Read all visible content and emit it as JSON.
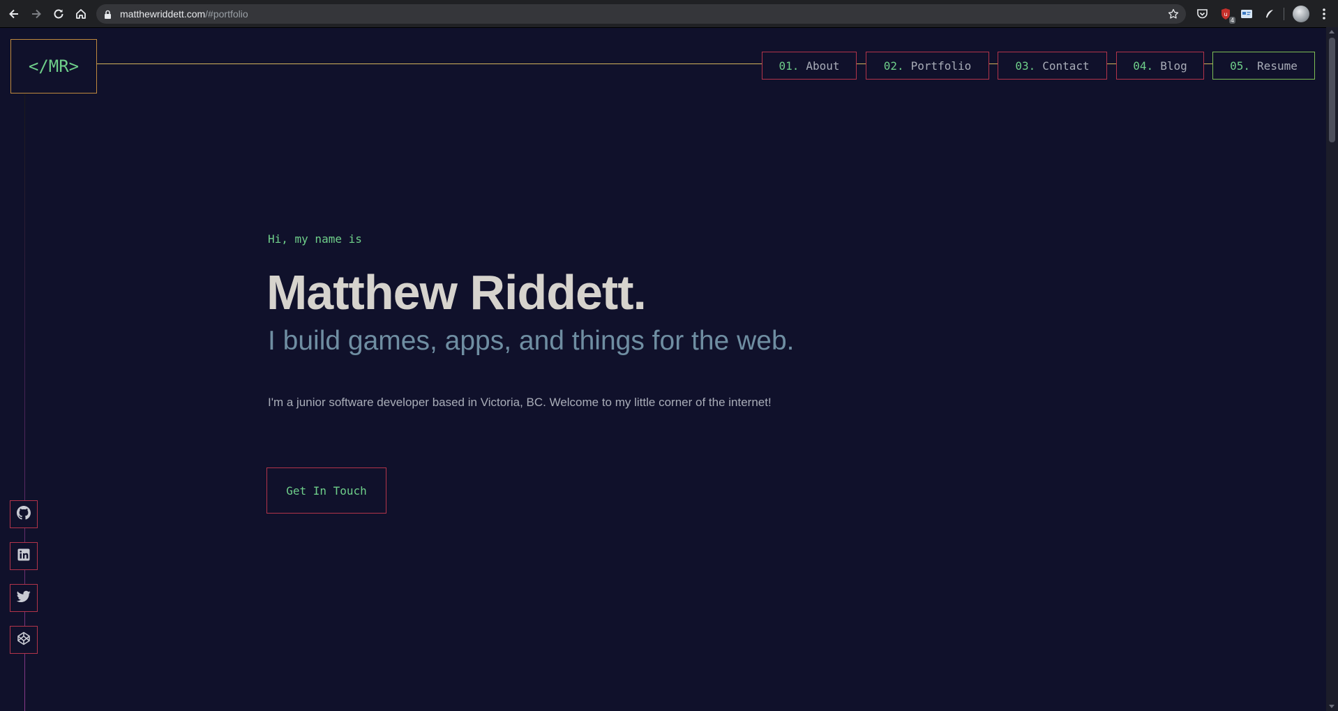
{
  "browser": {
    "url_domain": "matthewriddett.com",
    "url_path": "/#portfolio",
    "extension_badge": "4"
  },
  "logo": {
    "text": "</MR>"
  },
  "nav": [
    {
      "num": "01.",
      "label": "About"
    },
    {
      "num": "02.",
      "label": "Portfolio"
    },
    {
      "num": "03.",
      "label": "Contact"
    },
    {
      "num": "04.",
      "label": "Blog"
    },
    {
      "num": "05.",
      "label": "Resume"
    }
  ],
  "hero": {
    "greeting": "Hi, my name is",
    "name": "Matthew Riddett.",
    "tagline": "I build games, apps, and things for the web.",
    "intro": "I'm a junior software developer based in Victoria, BC. Welcome to my little corner of the internet!",
    "cta_label": "Get In Touch"
  },
  "social": [
    {
      "icon": "github-icon"
    },
    {
      "icon": "linkedin-icon"
    },
    {
      "icon": "twitter-icon"
    },
    {
      "icon": "codepen-icon"
    }
  ],
  "colors": {
    "background": "#10112b",
    "accent_green": "#6fcf8a",
    "accent_red": "#b3344a",
    "accent_gold": "#d3b45c",
    "name_text": "#d6d3cd",
    "tagline_text": "#6f8ea2"
  }
}
